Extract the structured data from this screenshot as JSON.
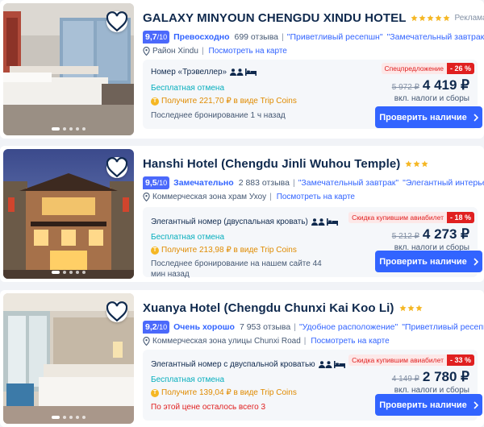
{
  "colors": {
    "accent": "#3264ff",
    "rating_badge": "#4b69fb",
    "star": "#f5b724",
    "discount": "#e02020",
    "free_cancel": "#06aebd",
    "coins": "#e08b00",
    "room_box_bg": "#f5f7fa"
  },
  "hotels": [
    {
      "name": "GALAXY MINYOUN CHENGDU XINDU HOTEL",
      "stars": 5,
      "ad_label": "Реклама",
      "rating": "9,7",
      "rating_max": "/10",
      "rating_word": "Превосходно",
      "reviews": "699 отзыва",
      "tags": [
        "\"Приветливый ресепшн\"",
        "\"Замечательный завтрак\""
      ],
      "location": "Район Xindu",
      "map_link": "Посмотреть на карте",
      "room_name": "Номер «Трэвеллер»",
      "free_cancel": "Бесплатная отмена",
      "coins_icon": "coin-icon",
      "coins_text": "Получите 221,70 ₽ в виде Trip Coins",
      "extra_note": "Последнее бронирование 1 ч назад",
      "deal_label": "Спецпредложение",
      "deal_pct": "- 26 %",
      "old_price": "5 972 ₽",
      "new_price": "4 419 ₽",
      "tax_note": "вкл. налоги и сборы",
      "button_label": "Проверить наличие"
    },
    {
      "name": "Hanshi Hotel (Chengdu Jinli Wuhou Temple)",
      "stars": 3,
      "rating": "9,5",
      "rating_max": "/10",
      "rating_word": "Замечательно",
      "reviews": "2 883 отзыва",
      "tags": [
        "\"Замечательный завтрак\"",
        "\"Элегантный интерьер\""
      ],
      "location": "Коммерческая зона храм Ухоу",
      "map_link": "Посмотреть на карте",
      "room_name": "Элегантный номер (двуспальная кровать)",
      "free_cancel": "Бесплатная отмена",
      "coins_icon": "coin-icon",
      "coins_text": "Получите 213,98 ₽ в виде Trip Coins",
      "extra_note": "Последнее бронирование на нашем сайте 44 мин назад",
      "deal_label": "Скидка купившим авиабилет",
      "deal_pct": "- 18 %",
      "old_price": "5 212 ₽",
      "new_price": "4 273 ₽",
      "tax_note": "вкл. налоги и сборы",
      "button_label": "Проверить наличие"
    },
    {
      "name": "Xuanya Hotel (Chengdu Chunxi Kai Koo Li)",
      "stars": 3,
      "rating": "9,2",
      "rating_max": "/10",
      "rating_word": "Очень хорошо",
      "reviews": "7 953 отзыва",
      "tags": [
        "\"Удобное расположение\"",
        "\"Приветливый ресепшн\""
      ],
      "location": "Коммерческая зона улицы Chunxi Road",
      "map_link": "Посмотреть на карте",
      "room_name": "Элегантный номер с двуспальной кроватью",
      "free_cancel": "Бесплатная отмена",
      "coins_icon": "coin-icon",
      "coins_text": "Получите 139,04 ₽ в виде Trip Coins",
      "extra_note": "По этой цене осталось всего 3",
      "deal_label": "Скидка купившим авиабилет",
      "deal_pct": "- 33 %",
      "old_price": "4 149 ₽",
      "new_price": "2 780 ₽",
      "tax_note": "вкл. налоги и сборы",
      "button_label": "Проверить наличие"
    }
  ]
}
